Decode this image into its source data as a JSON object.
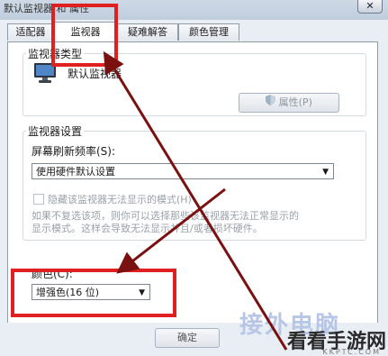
{
  "window": {
    "title": "默认监视器 和 属性",
    "close_label": "✕"
  },
  "tabs": [
    {
      "label": "适配器"
    },
    {
      "label": "监视器"
    },
    {
      "label": "疑难解答"
    },
    {
      "label": "颜色管理"
    }
  ],
  "monitor_type": {
    "group_label": "监视器类型",
    "monitor_name": "默认监视器",
    "properties_button": "属性(P)"
  },
  "monitor_settings": {
    "group_label": "监视器设置",
    "refresh_label": "屏幕刷新频率(S):",
    "refresh_value": "使用硬件默认设置",
    "hide_modes_label": "隐藏该监视器无法显示的模式(H)",
    "hint_line1": "如果不复选该项，则你可以选择那些该监视器无法正常显示的",
    "hint_line2": "显示模式。这样会导致无法显示并且/或者损坏硬件。"
  },
  "colors": {
    "label": "颜色(C):",
    "value": "增强色(16 位)"
  },
  "footer": {
    "ok_button": "确定"
  },
  "watermark": {
    "text": "看看手游网",
    "sub": "KKPTC.COM",
    "brand": "接外电脑"
  },
  "accent_colors": {
    "annotation_red": "#e02020",
    "arrow_dark": "#7a1010"
  }
}
